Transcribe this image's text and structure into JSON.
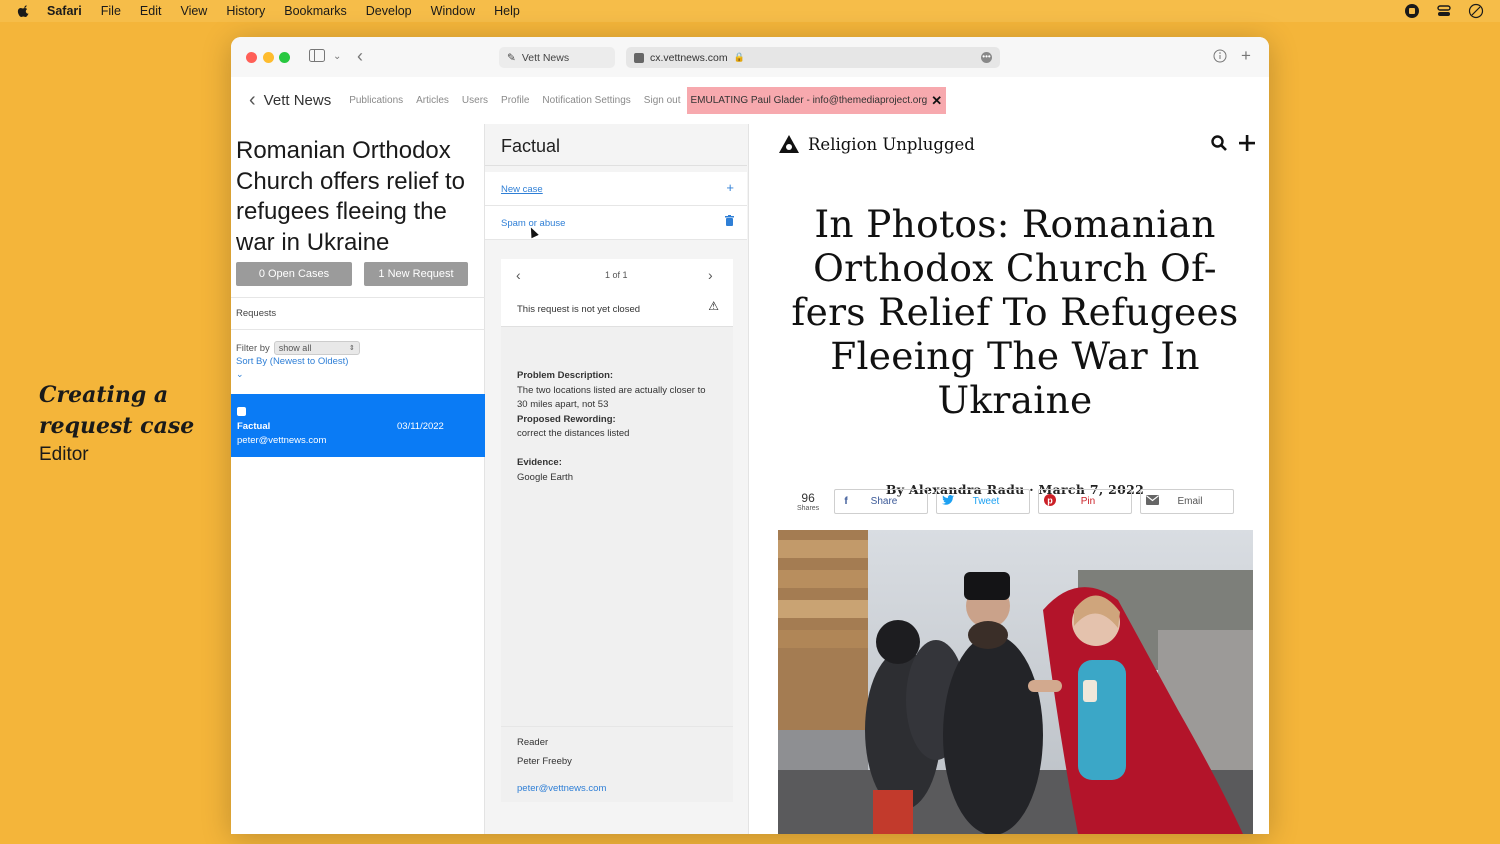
{
  "menubar": {
    "app": "Safari",
    "items": [
      "File",
      "Edit",
      "View",
      "History",
      "Bookmarks",
      "Develop",
      "Window",
      "Help"
    ]
  },
  "caption": {
    "line1": "Creating a",
    "line2": "request case",
    "line3": "Editor"
  },
  "browser": {
    "tab_title": "Vett News",
    "url": "cx.vettnews.com"
  },
  "appnav": {
    "brand": "Vett News",
    "links": [
      "Publications",
      "Articles",
      "Users",
      "Profile",
      "Notification Settings",
      "Sign out"
    ],
    "emulating": "EMULATING Paul Glader - info@themediaproject.org"
  },
  "article_panel": {
    "title": "Romanian Orthodox Church offers relief to refugees fleeing the war in Ukraine",
    "open_cases": "0 Open Cases",
    "new_request": "1 New Request",
    "requests_label": "Requests",
    "filter_label": "Filter by",
    "filter_value": "show all",
    "sort_label": "Sort By (Newest to Oldest)",
    "item": {
      "type": "Factual",
      "email": "peter@vettnews.com",
      "date": "03/11/2022"
    }
  },
  "request_panel": {
    "heading": "Factual",
    "new_case": "New case",
    "spam": "Spam or abuse",
    "pagination": "1 of 1",
    "status": "This request is not yet closed",
    "problem_label": "Problem Description:",
    "problem_text": "The two locations listed are actually closer to 30 miles apart, not 53",
    "rewording_label": "Proposed Rewording:",
    "rewording_text": "correct the distances listed",
    "evidence_label": "Evidence:",
    "evidence_text": "Google Earth",
    "reader_label": "Reader",
    "reader_name": "Peter Freeby",
    "reader_email": "peter@vettnews.com"
  },
  "site": {
    "logo_text": "Religion Unplugged",
    "headline": "In Photos: Romanian Orthodox Church Of-fers Relief To Refugees Fleeing The War In Ukraine",
    "author": "By Alexandra Radu",
    "separator": "·",
    "date": "March 7, 2022",
    "share_count": "96",
    "share_count_label": "Shares",
    "share_buttons": [
      {
        "label": "Share",
        "icon": "facebook-icon",
        "color": "#3b5998"
      },
      {
        "label": "Tweet",
        "icon": "twitter-icon",
        "color": "#1da1f2"
      },
      {
        "label": "Pin",
        "icon": "pinterest-icon",
        "color": "#cb2027"
      },
      {
        "label": "Email",
        "icon": "email-icon",
        "color": "#555555"
      }
    ]
  },
  "colors": {
    "accent_blue": "#0a7bf5",
    "link_blue": "#2f7fd6",
    "background": "#f4b53a",
    "emulating_bg": "#f7a9ae"
  }
}
